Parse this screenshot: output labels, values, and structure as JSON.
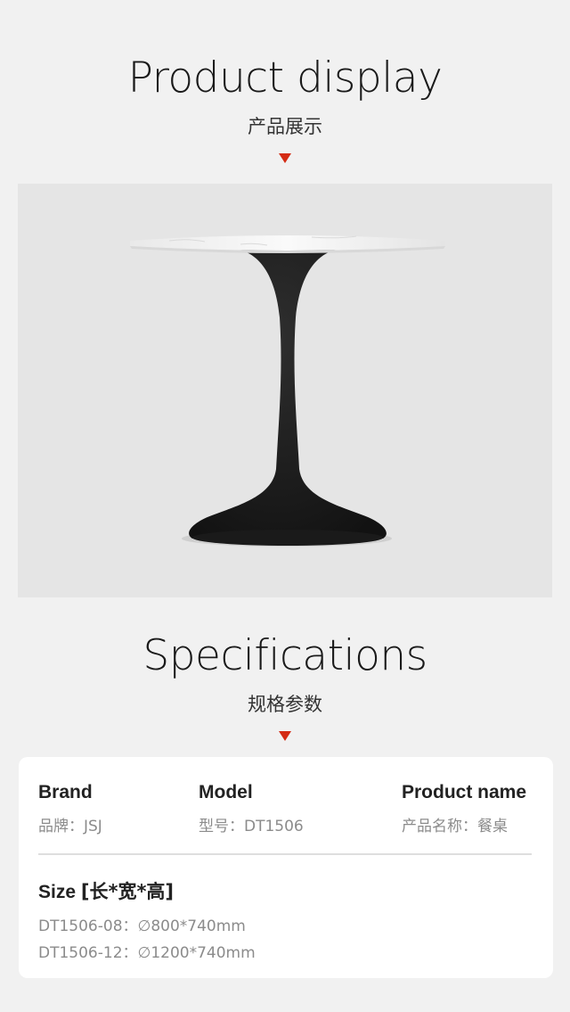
{
  "display": {
    "title": "Product display",
    "subtitle": "产品展示"
  },
  "specs": {
    "title": "Specifications",
    "subtitle": "规格参数"
  },
  "card": {
    "brand": {
      "label": "Brand",
      "value": "品牌：JSJ"
    },
    "model": {
      "label": "Model",
      "value": "型号：DT1506"
    },
    "product_name": {
      "label": "Product name",
      "value": "产品名称：餐桌"
    },
    "size": {
      "label": "Size",
      "label_cn": "[长*宽*高]",
      "lines": [
        "DT1506-08：∅800*740mm",
        "DT1506-12：∅1200*740mm"
      ]
    }
  },
  "colors": {
    "accent": "#d42b14",
    "background": "#f1f1f1",
    "photo_background": "#e5e5e5",
    "table_base": "#1a1a1a",
    "table_top": "#f4f4f4"
  }
}
